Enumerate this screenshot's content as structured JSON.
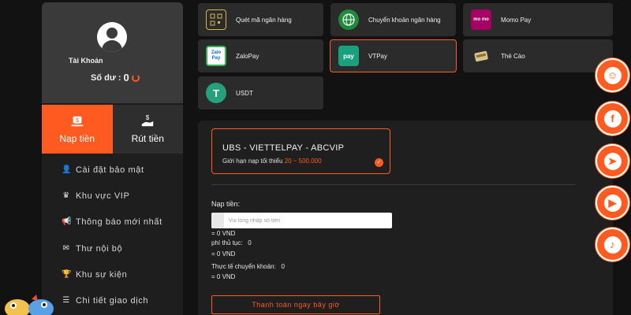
{
  "account": {
    "name": "Tài Khoản",
    "balance_label": "Số dư :",
    "balance_value": "0"
  },
  "tabs": [
    {
      "label": "Nạp tiền",
      "icon": "deposit-icon",
      "active": true
    },
    {
      "label": "Rút tiền",
      "icon": "withdraw-icon",
      "active": false
    }
  ],
  "menu": [
    {
      "label": "Cài đặt bảo mật",
      "icon": "user-lock-icon"
    },
    {
      "label": "Khu vực VIP",
      "icon": "crown-icon"
    },
    {
      "label": "Thông báo mới nhất",
      "icon": "megaphone-icon"
    },
    {
      "label": "Thư nội bộ",
      "icon": "envelope-icon"
    },
    {
      "label": "Khu sự kiện",
      "icon": "trophy-icon"
    },
    {
      "label": "Chi tiết giao dịch",
      "icon": "list-icon"
    }
  ],
  "payment_methods": [
    {
      "label": "Quét mã ngân hàng",
      "icon": "qr-scan-icon",
      "selected": false
    },
    {
      "label": "Chuyển khoản ngân hàng",
      "icon": "globe-icon",
      "selected": false
    },
    {
      "label": "Momo Pay",
      "icon": "momo-icon",
      "icon_text": "mo mo",
      "selected": false
    },
    {
      "label": "ZaloPay",
      "icon": "zalopay-icon",
      "icon_text": "Zalo Pay",
      "selected": false
    },
    {
      "label": "VTPay",
      "icon": "vtpay-icon",
      "icon_text": "pay",
      "selected": true
    },
    {
      "label": "Thẻ Cào",
      "icon": "scratch-card-icon",
      "selected": false
    },
    {
      "label": "USDT",
      "icon": "tether-icon",
      "icon_text": "T",
      "selected": false
    }
  ],
  "channel": {
    "title": "UBS - VIETTELPAY - ABCVIP",
    "limit_label": "Giới hạn nạp tối thiểu",
    "limit_range": "20 ~ 500.000"
  },
  "form": {
    "amount_label": "Nạp tiền:",
    "amount_placeholder": "Vui lòng nhập số tiền",
    "amount_vnd": "= 0 VND",
    "fee_label": "phí thủ tục:",
    "fee_value": "0",
    "fee_vnd": "= 0 VND",
    "actual_label": "Thực tế chuyển khoản:",
    "actual_value": "0",
    "actual_vnd": "= 0 VND",
    "submit_label": "Thanh toán ngay bây giờ"
  },
  "social": [
    {
      "icon": "support-chat-icon",
      "glyph": "☺"
    },
    {
      "icon": "facebook-icon",
      "glyph": "f"
    },
    {
      "icon": "telegram-icon",
      "glyph": "➤"
    },
    {
      "icon": "youtube-icon",
      "glyph": "▶"
    },
    {
      "icon": "tiktok-icon",
      "glyph": "♪"
    }
  ],
  "colors": {
    "accent": "#ff5a1f",
    "background": "#121212",
    "card": "#2b2b2b"
  }
}
